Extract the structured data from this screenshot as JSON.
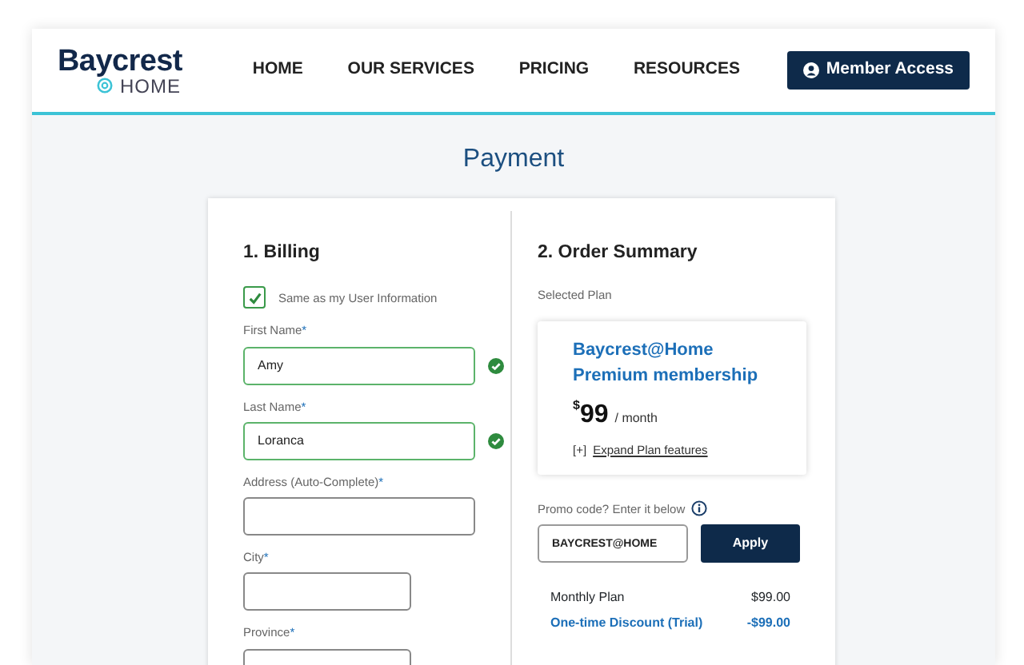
{
  "header": {
    "logo": {
      "name": "Baycrest",
      "sub": "HOME"
    },
    "nav": [
      {
        "label": "HOME"
      },
      {
        "label": "OUR SERVICES"
      },
      {
        "label": "PRICING"
      },
      {
        "label": "RESOURCES"
      }
    ],
    "member_button": "Member Access"
  },
  "page_title": "Payment",
  "billing": {
    "heading": "1. Billing",
    "same_as_user": {
      "label": "Same as my User Information",
      "checked": true
    },
    "fields": [
      {
        "label": "First Name",
        "required_mark": "*",
        "value": "Amy",
        "valid": true,
        "kind": "wide"
      },
      {
        "label": "Last Name",
        "required_mark": "*",
        "value": "Loranca",
        "valid": true,
        "kind": "wide"
      },
      {
        "label": "Address (Auto-Complete)",
        "required_mark": "*",
        "valid": false,
        "kind": "wide"
      },
      {
        "label": "City",
        "required_mark": "*",
        "valid": false,
        "kind": "short"
      },
      {
        "label": "Province",
        "required_mark": "*",
        "valid": false,
        "kind": "short"
      }
    ]
  },
  "order_summary": {
    "heading": "2. Order Summary",
    "selected_plan_label": "Selected Plan",
    "plan": {
      "name": "Baycrest@Home",
      "tier": "Premium membership",
      "currency": "$",
      "price": "99",
      "period": "/ month",
      "expand_prefix": "[+]",
      "expand_link": "Expand Plan features"
    },
    "promo": {
      "label": "Promo code? Enter it below",
      "value": "BAYCREST@HOME",
      "button": "Apply"
    },
    "lines": [
      {
        "label": "Monthly Plan",
        "amount": "$99.00",
        "kind": "charge"
      },
      {
        "label": "One-time Discount (Trial)",
        "amount": "-$99.00",
        "kind": "discount"
      }
    ]
  }
}
